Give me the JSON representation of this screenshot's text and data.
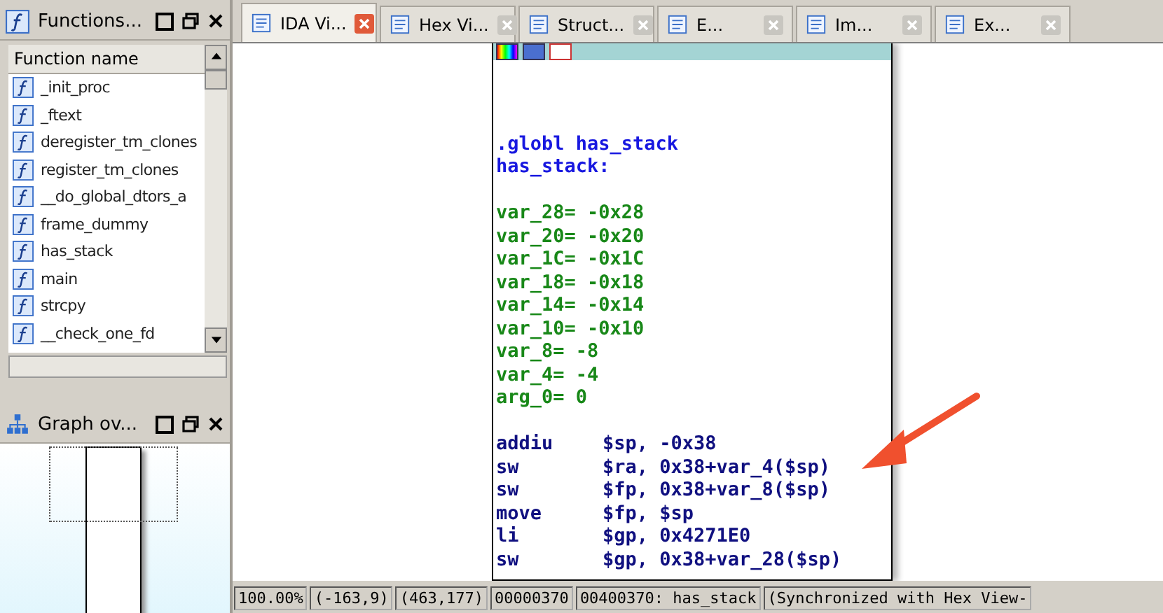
{
  "functions_panel": {
    "title": "Functions...",
    "column": "Function name",
    "items": [
      {
        "name": "_init_proc",
        "selected": false
      },
      {
        "name": "_ftext",
        "selected": false
      },
      {
        "name": "deregister_tm_clones",
        "selected": false
      },
      {
        "name": "register_tm_clones",
        "selected": false
      },
      {
        "name": "__do_global_dtors_a",
        "selected": false
      },
      {
        "name": "frame_dummy",
        "selected": false
      },
      {
        "name": "has_stack",
        "selected": false
      },
      {
        "name": "main",
        "selected": false
      },
      {
        "name": "strcpy",
        "selected": false
      },
      {
        "name": "__check_one_fd",
        "selected": false
      }
    ]
  },
  "graph_overview": {
    "title": "Graph ov..."
  },
  "tabs": [
    {
      "label": "IDA Vi...",
      "selected": true
    },
    {
      "label": "Hex Vi...",
      "selected": false
    },
    {
      "label": "Struct...",
      "selected": false
    },
    {
      "label": "E...",
      "selected": false
    },
    {
      "label": "Im...",
      "selected": false
    },
    {
      "label": "Ex...",
      "selected": false
    }
  ],
  "code_lines": [
    {
      "kind": "blank"
    },
    {
      "kind": "blank"
    },
    {
      "kind": "blank"
    },
    {
      "kind": "label",
      "text": ".globl has_stack"
    },
    {
      "kind": "label",
      "text": "has_stack:"
    },
    {
      "kind": "blank"
    },
    {
      "kind": "var",
      "text": "var_28= -0x28"
    },
    {
      "kind": "var",
      "text": "var_20= -0x20"
    },
    {
      "kind": "var",
      "text": "var_1C= -0x1C"
    },
    {
      "kind": "var",
      "text": "var_18= -0x18"
    },
    {
      "kind": "var",
      "text": "var_14= -0x14"
    },
    {
      "kind": "var",
      "text": "var_10= -0x10"
    },
    {
      "kind": "var",
      "text": "var_8= -8"
    },
    {
      "kind": "var",
      "text": "var_4= -4"
    },
    {
      "kind": "var",
      "text": "arg_0=  0"
    },
    {
      "kind": "blank"
    },
    {
      "kind": "insn",
      "mnemonic": "addiu",
      "operands": "$sp, -0x38"
    },
    {
      "kind": "insn",
      "mnemonic": "sw",
      "operands": "$ra, 0x38+var_4($sp)"
    },
    {
      "kind": "insn",
      "mnemonic": "sw",
      "operands": "$fp, 0x38+var_8($sp)"
    },
    {
      "kind": "insn",
      "mnemonic": "move",
      "operands": "$fp, $sp"
    },
    {
      "kind": "insn",
      "mnemonic": "li",
      "operands": "$gp, 0x4271E0"
    },
    {
      "kind": "insn",
      "mnemonic": "sw",
      "operands": "$gp, 0x38+var_28($sp)"
    }
  ],
  "status_bar": [
    "100.00%",
    "(-163,9)",
    "(463,177)",
    "00000370",
    "00400370: has_stack",
    "(Synchronized with Hex View-"
  ]
}
